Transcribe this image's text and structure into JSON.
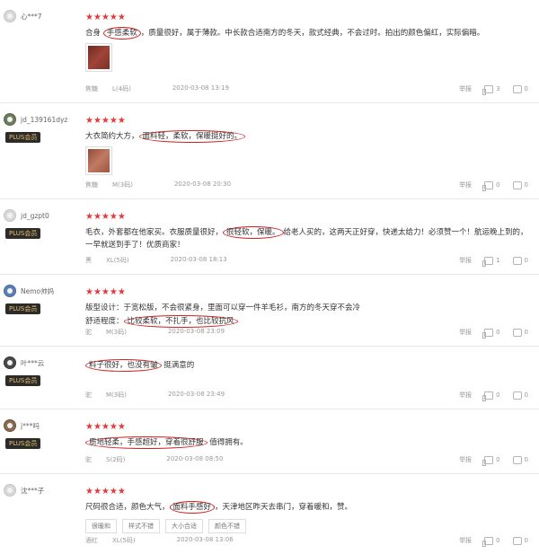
{
  "reviews": [
    {
      "username": "心***7",
      "plus": "",
      "text_before": "合身 ",
      "highlight": "手感柔软",
      "text_after": "，质量很好，属于薄款。中长款合适南方的冬天，款式经典，不会过时。拍出的颜色偏红，实际偏暗。",
      "has_image": true,
      "color": "焦糖",
      "size": "L(4码)",
      "date": "2020-03-08 13:19",
      "report": "举报",
      "likes": "3",
      "comments": "0"
    },
    {
      "username": "jd_139161dyz",
      "plus": "PLUS会员",
      "text_before": "大衣简约大方，",
      "highlight": "面料轻，柔软，保暖挺好的。",
      "text_after": "",
      "has_image": true,
      "color": "焦糖",
      "size": "M(3码)",
      "date": "2020-03-08 20:30",
      "report": "举报",
      "likes": "0",
      "comments": "0"
    },
    {
      "username": "jd_gzpt0",
      "plus": "PLUS会员",
      "text_before": "毛衣，外套都在他家买。衣服质量很好，",
      "highlight": "很轻软，保暖。",
      "text_after": "给老人买的，这两天正好穿，快递太给力！必须赞一个！航运晚上到的，一早就送到手了！优质商家！",
      "has_image": false,
      "color": "黑",
      "size": "XL(5码)",
      "date": "2020-03-08 18:13",
      "report": "举报",
      "likes": "1",
      "comments": "0"
    },
    {
      "username": "Nemo帅妈",
      "plus": "PLUS会员",
      "line1": "版型设计：于宽松版，不会很紧身，里面可以穿一件羊毛衫，南方的冬天穿不会冷",
      "text_before": "舒适程度：",
      "highlight": "比较柔软，不扎手，也比较抗风",
      "text_after": "",
      "has_image": false,
      "color": "驼",
      "size": "M(3码)",
      "date": "2020-03-08 23:09",
      "report": "举报",
      "likes": "0",
      "comments": "0"
    },
    {
      "username": "叶***云",
      "plus": "PLUS会员",
      "text_before": "",
      "highlight": "料子很好，也没有皱",
      "text_after": " 挺满意的",
      "has_image": false,
      "color": "驼",
      "size": "M(3码)",
      "date": "2020-03-08 23:49",
      "report": "举报",
      "likes": "0",
      "comments": "0"
    },
    {
      "username": "j***吗",
      "plus": "PLUS会员",
      "text_before": "",
      "highlight": "质地轻柔，手感超好，穿着很舒服",
      "text_after": " 值得拥有。",
      "has_image": false,
      "color": "驼",
      "size": "S(2码)",
      "date": "2020-03-08 08:50",
      "report": "举报",
      "likes": "0",
      "comments": "0"
    },
    {
      "username": "沈***子",
      "plus": "",
      "text_before": "尺码很合适，颜色大气，",
      "highlight": "面料手感好",
      "text_after": "，天津地区昨天去串门，穿着暖和，赞。",
      "has_image": false,
      "tags": [
        "很暖和",
        "样式不错",
        "大小合适",
        "颜色不错"
      ],
      "color": "酒红",
      "size": "XL(5码)",
      "date": "2020-03-08 13:06",
      "report": "举报",
      "likes": "0",
      "comments": "0"
    }
  ],
  "stars_glyph": "★★★★★",
  "colors": {
    "accent": "#e4393c",
    "highlight_ring": "#d11f1f",
    "plus_badge_bg": "#2b2b2b",
    "plus_badge_text": "#e8c06a"
  }
}
